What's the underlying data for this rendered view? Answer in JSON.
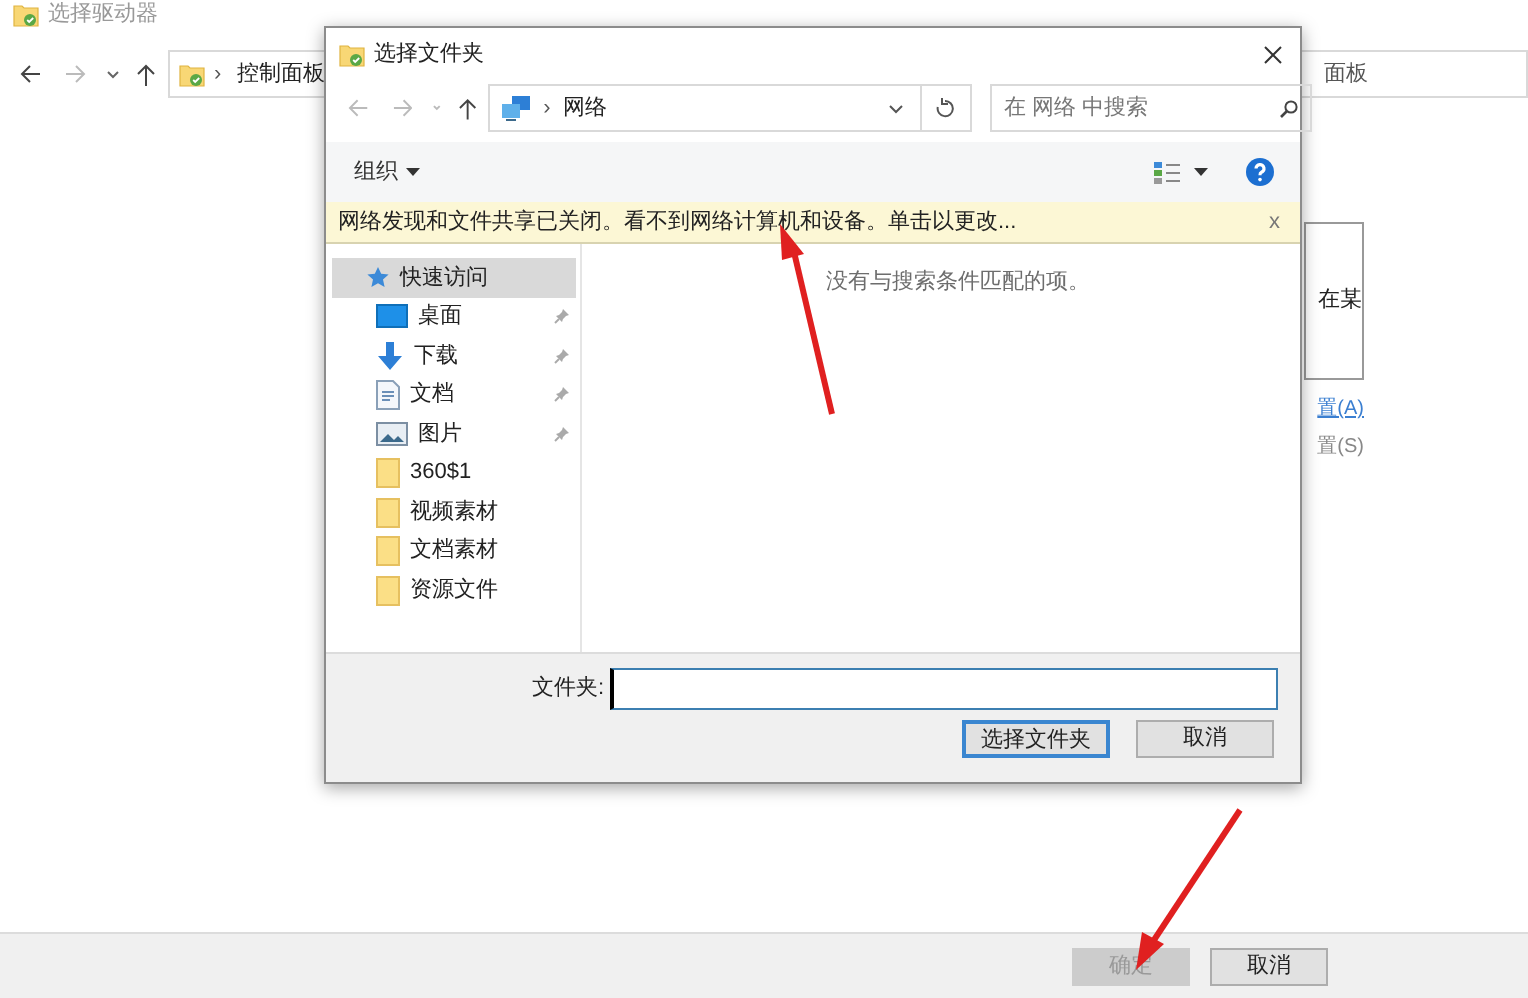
{
  "background_window": {
    "title": "选择驱动器",
    "separator": "›",
    "breadcrumb": "控制面板",
    "address_tail": "面板",
    "panel_text": "在某",
    "links": [
      {
        "label": "置(A)",
        "kind": "link"
      },
      {
        "label": "置(S)",
        "kind": "text"
      }
    ],
    "buttons": [
      {
        "label": "确定",
        "disabled": true
      },
      {
        "label": "取消",
        "disabled": false
      }
    ]
  },
  "dialog": {
    "title": "选择文件夹",
    "separator": "›",
    "location": "网络",
    "search": {
      "placeholder": "在 网络 中搜索"
    },
    "organize": "组织",
    "info_bar": {
      "text": "网络发现和文件共享已关闭。看不到网络计算机和设备。单击以更改...",
      "close": "x"
    },
    "sidebar": [
      {
        "label": "快速访问",
        "kind": "star",
        "selected": true,
        "children": [
          {
            "label": "桌面",
            "kind": "desktop",
            "pinned": true,
            "selected": false
          },
          {
            "label": "下载",
            "kind": "download",
            "pinned": true,
            "selected": false
          },
          {
            "label": "文档",
            "kind": "document",
            "pinned": true,
            "selected": false
          },
          {
            "label": "图片",
            "kind": "pictures",
            "pinned": true,
            "selected": false
          },
          {
            "label": "360$1",
            "kind": "folder",
            "pinned": false,
            "selected": false
          },
          {
            "label": "视频素材",
            "kind": "folder",
            "pinned": false,
            "selected": false
          },
          {
            "label": "文档素材",
            "kind": "folder",
            "pinned": false,
            "selected": false
          },
          {
            "label": "资源文件",
            "kind": "folder",
            "pinned": false,
            "selected": false
          }
        ]
      }
    ],
    "empty_message": "没有与搜索条件匹配的项。",
    "folder_label": "文件夹:",
    "buttons": [
      {
        "label": "选择文件夹",
        "default": true
      },
      {
        "label": "取消",
        "default": false
      }
    ]
  }
}
